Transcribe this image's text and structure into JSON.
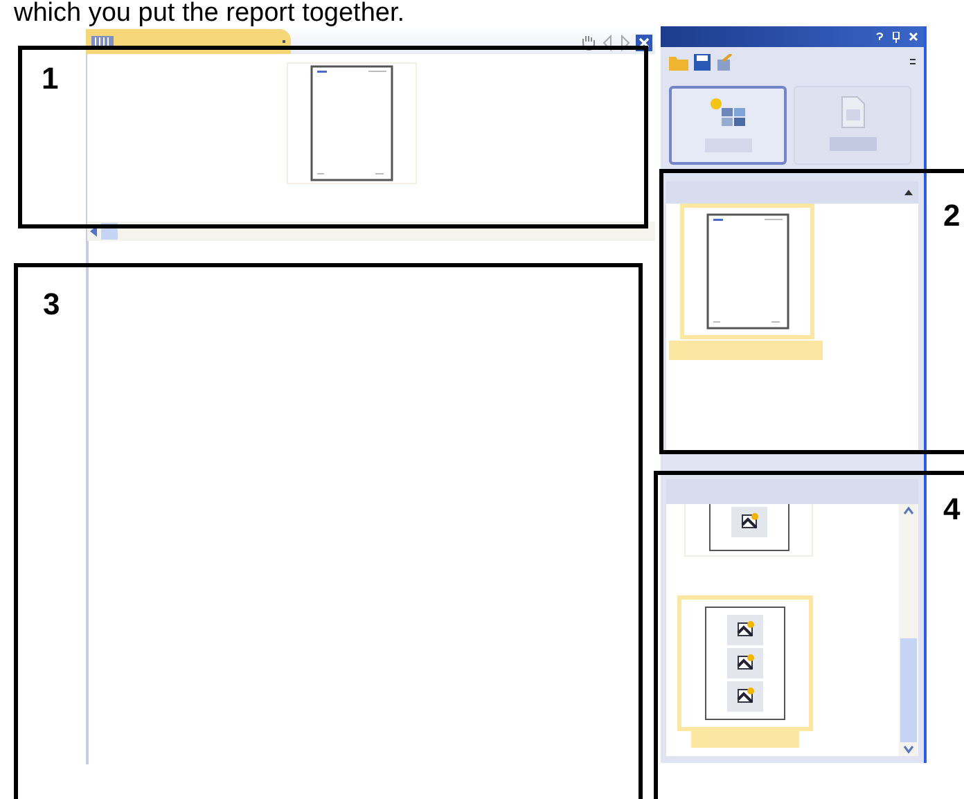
{
  "caption": "which you put the report together.",
  "document_tab": {
    "selected": true
  },
  "templates": [
    {
      "kind": "new",
      "disabled": false
    },
    {
      "kind": "word",
      "disabled": true
    }
  ],
  "callouts": [
    {
      "label": "1",
      "kind": "preview"
    },
    {
      "label": "2",
      "kind": "pages"
    },
    {
      "label": "3",
      "kind": "canvas"
    },
    {
      "label": "4",
      "kind": "elements"
    }
  ]
}
